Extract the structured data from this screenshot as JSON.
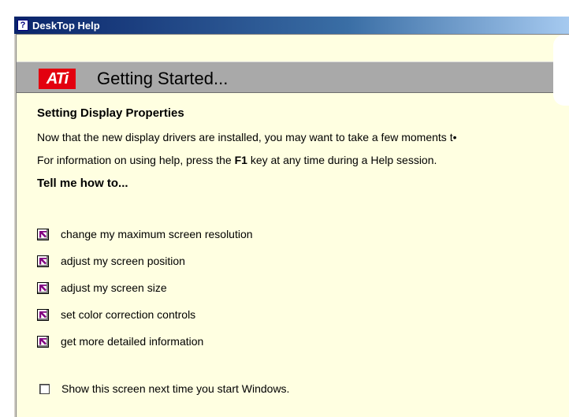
{
  "window": {
    "title": "DeskTop Help",
    "icon": "help-book-icon"
  },
  "banner": {
    "logo_text": "ATi",
    "title": "Getting Started..."
  },
  "content": {
    "section_title": "Setting Display Properties",
    "intro_text": "Now that the new display drivers are installed, you may want to take a few moments t•",
    "help_prefix": "For information on using help, press the",
    "help_key": "F1",
    "help_suffix": "key at any time during a Help session.",
    "tell_me_heading": "Tell me how to..."
  },
  "links": [
    {
      "label": "change my maximum screen resolution",
      "icon": "jump-arrow-icon"
    },
    {
      "label": "adjust my screen position",
      "icon": "jump-arrow-icon"
    },
    {
      "label": "adjust my screen size",
      "icon": "jump-arrow-icon"
    },
    {
      "label": "set color correction controls",
      "icon": "jump-arrow-icon"
    },
    {
      "label": "get more detailed information",
      "icon": "jump-arrow-icon"
    }
  ],
  "startup_checkbox": {
    "label": "Show this screen next time you start Windows.",
    "checked": false
  },
  "colors": {
    "background": "#ffffe1",
    "titlebar": "#0a246a",
    "banner_band": "#a9a9a9",
    "ati_red": "#e3000f",
    "link_icon": "#800080"
  }
}
